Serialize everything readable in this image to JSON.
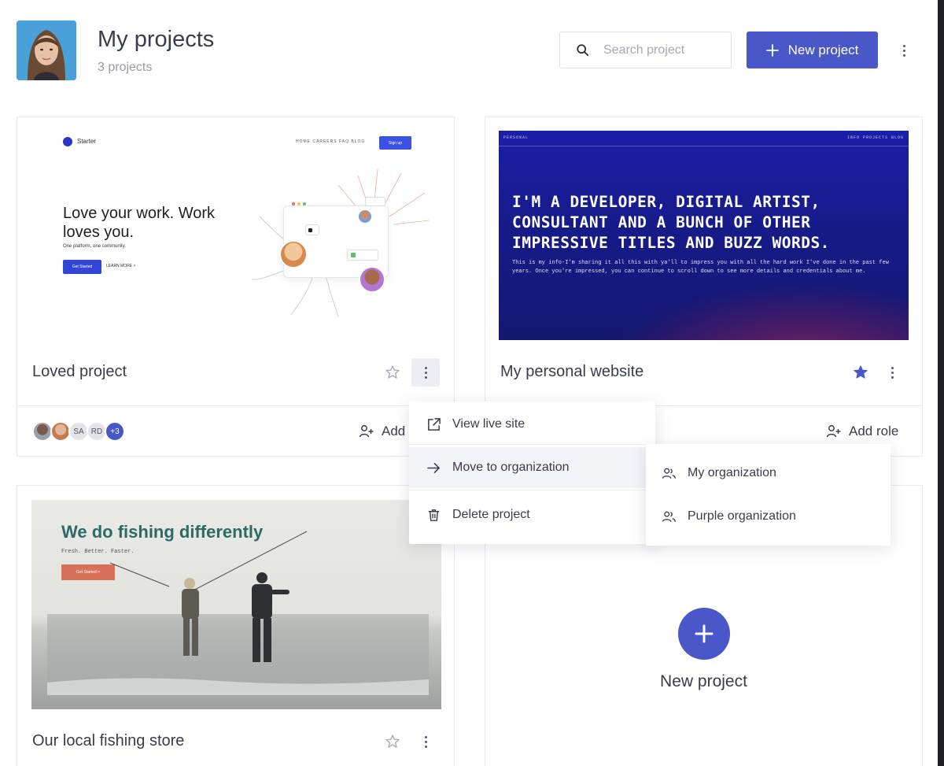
{
  "header": {
    "title": "My projects",
    "subtitle": "3 projects",
    "search_placeholder": "Search project",
    "new_project_label": "New project"
  },
  "colors": {
    "accent": "#4a57c9",
    "star_active": "#4a57c9",
    "star_inactive": "#b7b9c4"
  },
  "projects": [
    {
      "name": "Loved project",
      "starred": false,
      "members": [
        "SA",
        "RD",
        "+3"
      ],
      "add_role_label": "Add role",
      "preview": {
        "logo_text": "Starter",
        "nav": "HOME  CAREERS  FAQ  BLOG",
        "nav_button": "Sign up",
        "headline": "Love your work. Work loves you.",
        "sub": "One platform, one community.",
        "cta": "Get Started",
        "cta2": "LEARN MORE  >"
      }
    },
    {
      "name": "My personal website",
      "starred": true,
      "add_role_label": "Add role",
      "preview": {
        "bar_left": "PERSONAL",
        "bar_right": "INFO  PROJECTS  BLOG",
        "headline": "I'M A DEVELOPER, DIGITAL ARTIST, CONSULTANT AND A BUNCH OF OTHER IMPRESSIVE TITLES AND BUZZ WORDS.",
        "paragraph": "This is my info-I'm sharing it all this with ya'll to impress you with all the hard work I've done in the past few years. Once you're impressed, you can continue to scroll down to see more details and credentials about me."
      }
    },
    {
      "name": "Our local fishing store",
      "starred": false,
      "preview": {
        "headline": "We do fishing differently",
        "sub": "Fresh. Better. Faster.",
        "cta": "Get Started >"
      }
    }
  ],
  "new_project_card": {
    "label": "New project"
  },
  "project_menu": {
    "items": [
      {
        "label": "View live site",
        "icon": "external-link-icon"
      },
      {
        "label": "Move to organization",
        "icon": "arrow-right-icon"
      },
      {
        "label": "Delete project",
        "icon": "trash-icon"
      }
    ]
  },
  "org_submenu": {
    "items": [
      {
        "label": "My organization",
        "icon": "users-icon"
      },
      {
        "label": "Purple organization",
        "icon": "users-icon"
      }
    ]
  }
}
